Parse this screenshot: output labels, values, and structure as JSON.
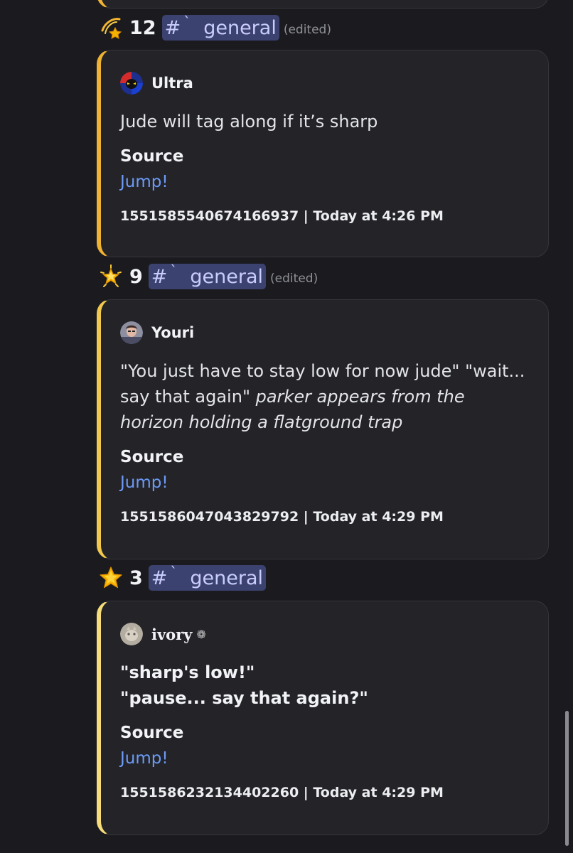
{
  "posts": [
    {
      "star_icon": "dizzy-star-icon",
      "count": "12",
      "channel_hash": "#",
      "channel_tick": "ˋ",
      "channel_name": "general",
      "edited": "(edited)",
      "author": "Ultra",
      "description": "Jude will tag along if it’s sharp",
      "field_name": "Source",
      "field_link": "Jump!",
      "footer": "1551585540674166937 | Today at 4:26 PM"
    },
    {
      "star_icon": "glowing-star-icon",
      "count": "9",
      "channel_hash": "#",
      "channel_tick": "ˋ",
      "channel_name": "general",
      "edited": "(edited)",
      "author": "Youri",
      "description_plain": "\"You just have to stay low for now jude\" \"wait... say that again\" ",
      "description_italic": "parker appears from the horizon holding a flatground trap",
      "field_name": "Source",
      "field_link": "Jump!",
      "footer": "1551586047043829792 | Today at 4:29 PM"
    },
    {
      "star_icon": "star-icon",
      "count": "3",
      "channel_hash": "#",
      "channel_tick": "ˋ",
      "channel_name": "general",
      "author": "ivory",
      "author_emoji": "❁",
      "description_line1": "\"sharp's low!\"",
      "description_line2": "\"pause... say that again?\"",
      "field_name": "Source",
      "field_link": "Jump!",
      "footer": "1551586232134402260 | Today at 4:29 PM"
    }
  ],
  "colors": {
    "background": "#1b1b1f",
    "embed_bg": "#232328",
    "accent_bar": "#f0b232",
    "link": "#6c9bf5",
    "mention_bg": "#3c4270",
    "mention_text": "#c9cdfb"
  }
}
